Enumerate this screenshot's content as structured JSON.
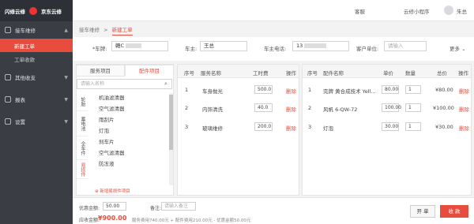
{
  "brand": {
    "logo1": "闪修云修",
    "logo2": "京东云修"
  },
  "sidebar": {
    "groups": [
      {
        "label": "接车维修",
        "subs": [
          "新建工单",
          "工单收款"
        ]
      },
      {
        "label": "其他收支"
      },
      {
        "label": "报表"
      },
      {
        "label": "设置"
      }
    ]
  },
  "topbar": {
    "service": "客服",
    "miniapp": "云修小程序",
    "user": "朱总"
  },
  "breadcrumb": {
    "parent": "接车维修",
    "sep": ">",
    "current": "新建工单"
  },
  "form": {
    "plate_label": "*车牌:",
    "plate_value": "赣C",
    "owner_label": "车主:",
    "owner_value": "王总",
    "phone_label": "车主电话:",
    "phone_value": "13",
    "unit_label": "客户单位:",
    "unit_placeholder": "请输入",
    "more": "更多"
  },
  "left": {
    "tabs": [
      "服务项目",
      "配件项目"
    ],
    "search_placeholder": "请输入名称",
    "categories": [
      "轮胎",
      "蓄电池",
      "全车件",
      "易损件"
    ],
    "parts": [
      "机油滤清器",
      "空气滤清器",
      "雨刮片",
      "灯泡",
      "刹车片",
      "空气滤清器",
      "防冻液"
    ],
    "add_label": "新增易损件项目"
  },
  "services": {
    "headers": [
      "序号",
      "服务名称",
      "工时费",
      "操作"
    ],
    "rows": [
      {
        "idx": "1",
        "name": "车身抛光",
        "fee": "500.0",
        "op": "删除"
      },
      {
        "idx": "2",
        "name": "内饰清洗",
        "fee": "40.0",
        "op": "删除"
      },
      {
        "idx": "3",
        "name": "玻璃维修",
        "fee": "200.0",
        "op": "删除"
      }
    ]
  },
  "parts_table": {
    "headers": [
      "序号",
      "配件名称",
      "单价",
      "数量",
      "总价",
      "操作"
    ],
    "rows": [
      {
        "idx": "1",
        "name": "完牌 黄合成技术 Yell...",
        "price": "80.00",
        "qty": "1",
        "total": "¥80.00",
        "op": "删除"
      },
      {
        "idx": "2",
        "name": "风帆 6-QW-72",
        "price": "100.00",
        "qty": "1",
        "total": "¥100.00",
        "op": "删除"
      },
      {
        "idx": "3",
        "name": "灯泡",
        "price": "30.00",
        "qty": "1",
        "total": "¥30.00",
        "op": "删除"
      }
    ]
  },
  "bottom": {
    "discount_label": "优惠金额:",
    "discount_value": "50.00",
    "note_label": "备注:",
    "note_placeholder": "请输入备注",
    "total_label": "应收金额:",
    "total_value": "¥900.00",
    "breakdown": "服务费用740.00元 + 配件费用210.00元 - 优惠金额50.00元",
    "open_btn": "开 单",
    "collect_btn": "收 款"
  },
  "colors": {
    "accent": "#e84c3d",
    "sidebar": "#3a3d44"
  }
}
